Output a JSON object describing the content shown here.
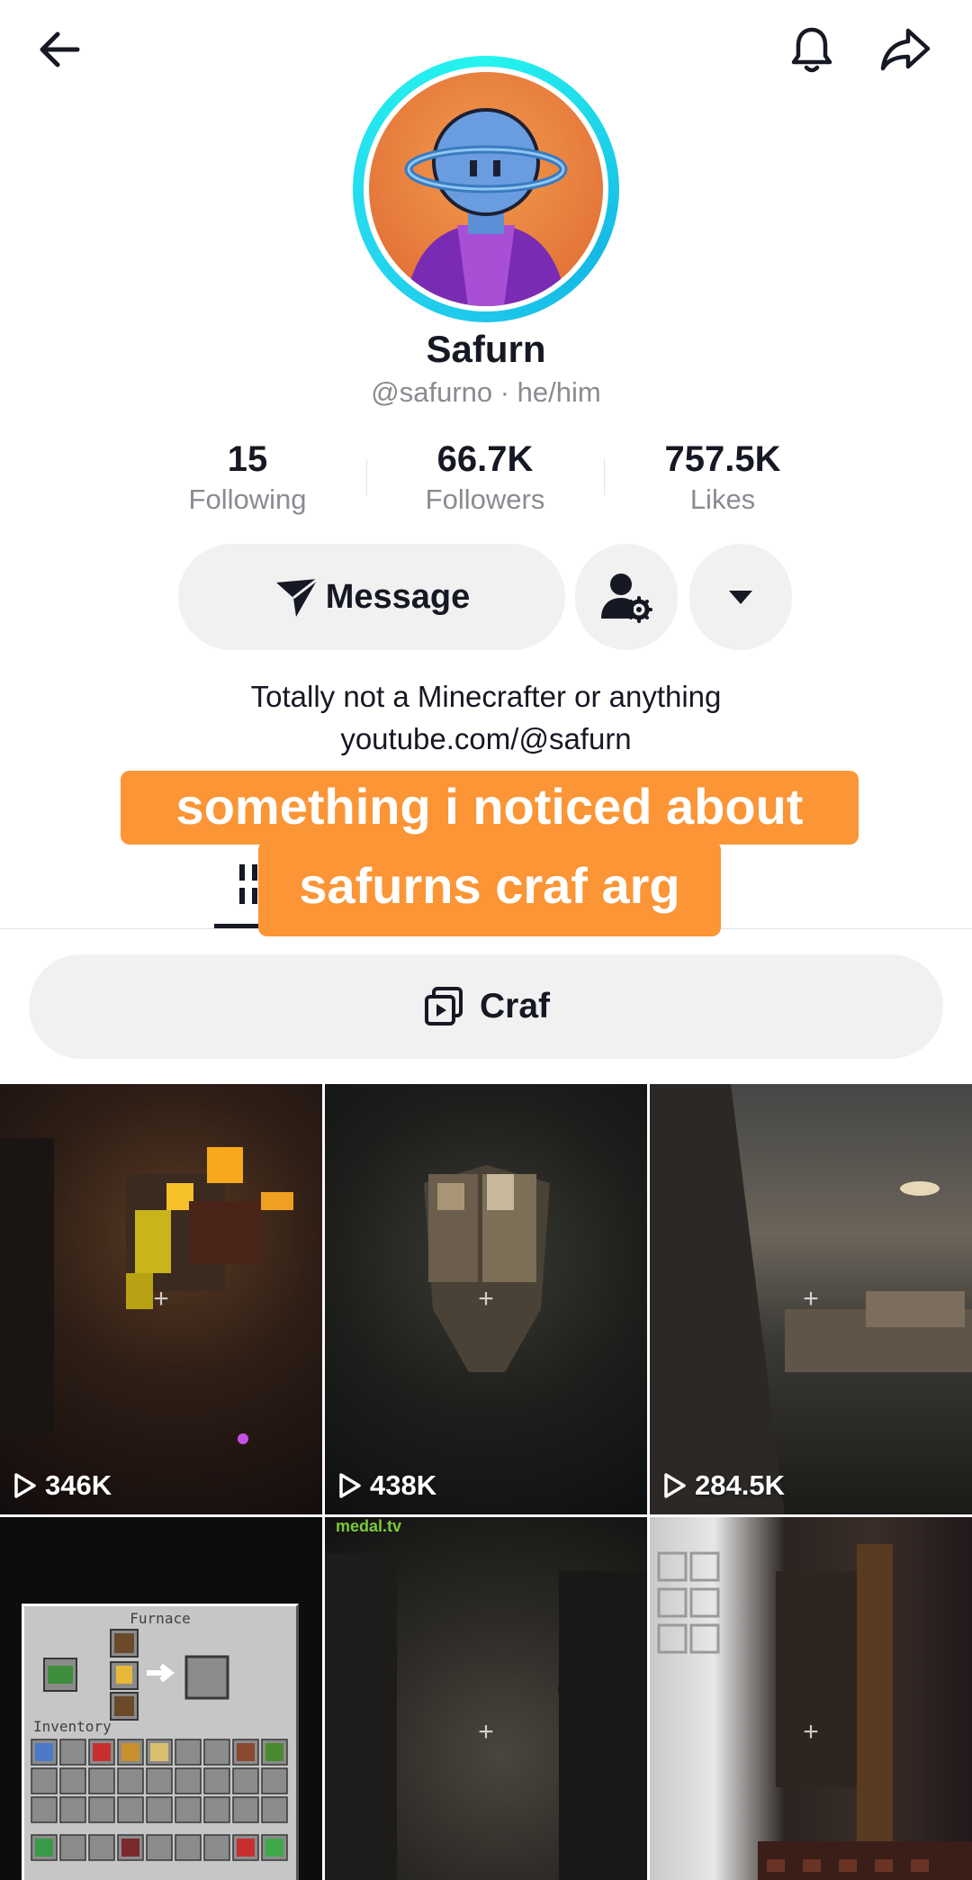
{
  "profile": {
    "name": "Safurn",
    "handle": "@safurno · he/him"
  },
  "stats": [
    {
      "value": "15",
      "label": "Following"
    },
    {
      "value": "66.7K",
      "label": "Followers"
    },
    {
      "value": "757.5K",
      "label": "Likes"
    }
  ],
  "actions": {
    "message_label": "Message"
  },
  "bio": {
    "line1": "Totally not a Minecrafter or anything",
    "line2": "youtube.com/@safurn"
  },
  "overlay": {
    "line1": "something i noticed about",
    "line2": "safurns craf arg"
  },
  "playlist": {
    "label": "Craf"
  },
  "videos": [
    {
      "views": "346K"
    },
    {
      "views": "438K"
    },
    {
      "views": "284.5K"
    },
    {
      "views": ""
    },
    {
      "views": ""
    },
    {
      "views": ""
    }
  ],
  "video_overlays": {
    "furnace_title": "Furnace",
    "inventory_label": "Inventory",
    "medal_watermark": "medal.tv"
  },
  "colors": {
    "accent_ring": "#25f4ee",
    "overlay_bg": "#fb9536",
    "button_bg": "#f1f1f2"
  },
  "icons": [
    "back-arrow-icon",
    "bell-icon",
    "share-icon",
    "send-icon",
    "add-friend-settings-icon",
    "chevron-down-icon",
    "grid-icon",
    "playlist-icon",
    "play-icon",
    "plus-icon"
  ]
}
